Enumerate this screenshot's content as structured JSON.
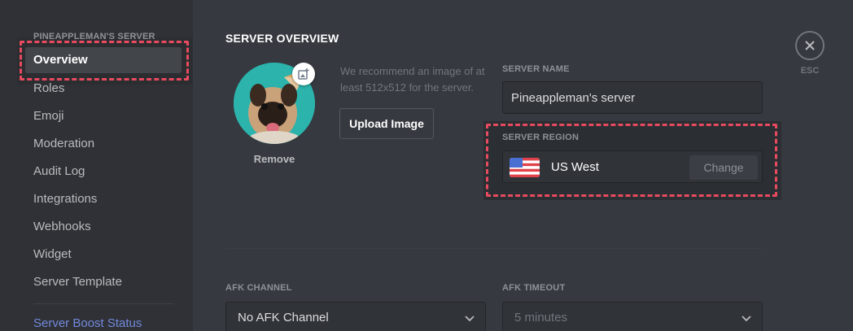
{
  "sidebar": {
    "guild_name": "PINEAPPLEMAN'S SERVER",
    "items": [
      {
        "label": "Overview",
        "selected": true
      },
      {
        "label": "Roles"
      },
      {
        "label": "Emoji"
      },
      {
        "label": "Moderation"
      },
      {
        "label": "Audit Log"
      },
      {
        "label": "Integrations"
      },
      {
        "label": "Webhooks"
      },
      {
        "label": "Widget"
      },
      {
        "label": "Server Template"
      }
    ],
    "boost_label": "Server Boost Status"
  },
  "main": {
    "title": "SERVER OVERVIEW",
    "icon": {
      "remove_label": "Remove",
      "upload_icon": "image-add-icon",
      "recommendation": "We recommend an image of at least 512x512 for the server.",
      "upload_button": "Upload Image"
    },
    "server_name": {
      "label": "SERVER NAME",
      "value": "Pineappleman's server"
    },
    "server_region": {
      "label": "SERVER REGION",
      "flag_icon": "us-flag-icon",
      "region": "US West",
      "change_button": "Change"
    },
    "afk_channel": {
      "label": "AFK CHANNEL",
      "value": "No AFK Channel"
    },
    "afk_timeout": {
      "label": "AFK TIMEOUT",
      "value": "5 minutes"
    }
  },
  "close": {
    "icon": "close-icon",
    "label": "ESC"
  },
  "colors": {
    "background": "#36393f",
    "sidebar": "#2f3136",
    "selected_item": "#42454a",
    "accent_blurple": "#7289da",
    "highlight_dash": "#e84a5f"
  }
}
